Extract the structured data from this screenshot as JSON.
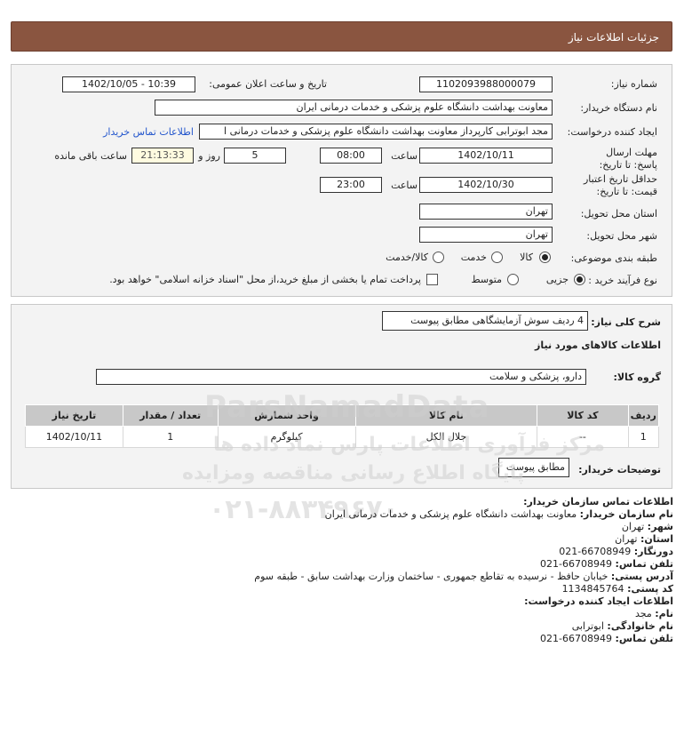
{
  "header": {
    "title": "جزئیات اطلاعات نیاز"
  },
  "form": {
    "need_number_label": "شماره نیاز:",
    "need_number": "1102093988000079",
    "announce_label": "تاریخ و ساعت اعلان عمومی:",
    "announce_value": "1402/10/05 - 10:39",
    "buyer_org_label": "نام دستگاه خریدار:",
    "buyer_org": "معاونت بهداشت دانشگاه علوم پزشکی و خدمات درمانی ایران",
    "creator_label": "ایجاد کننده درخواست:",
    "creator": "مجد ابوترابی کارپرداز معاونت بهداشت دانشگاه علوم پزشکی و خدمات درمانی ا",
    "contact_link": "اطلاعات تماس خریدار",
    "deadline_label": "مهلت ارسال پاسخ: تا تاریخ:",
    "deadline_date": "1402/10/11",
    "time_label": "ساعت",
    "deadline_time": "08:00",
    "days": "5",
    "days_label": "روز و",
    "remaining": "21:13:33",
    "remaining_label": "ساعت باقی مانده",
    "validity_label": "حداقل تاریخ اعتبار قیمت: تا تاریخ:",
    "validity_date": "1402/10/30",
    "validity_time_label": "ساعت",
    "validity_time": "23:00",
    "province_label": "استان محل تحویل:",
    "province": "تهران",
    "city_label": "شهر محل تحویل:",
    "city": "تهران",
    "category_label": "طبقه بندی موضوعی:",
    "category_options": [
      "کالا",
      "خدمت",
      "کالا/خدمت"
    ],
    "process_label": "نوع فرآیند خرید :",
    "process_options": [
      "جزیی",
      "متوسط"
    ],
    "payment_note": "پرداخت تمام یا بخشی از مبلغ خرید،از محل \"اسناد خزانه اسلامی\" خواهد بود."
  },
  "details": {
    "summary_label": "شرح کلی نیاز:",
    "summary": "4 ردیف سوش آزمایشگاهی مطابق پیوست",
    "goods_info_title": "اطلاعات کالاهای مورد نیاز",
    "group_label": "گروه کالا:",
    "group": "دارو، پزشکی و سلامت",
    "table_headers": [
      "ردیف",
      "کد کالا",
      "نام کالا",
      "واحد شمارش",
      "تعداد / مقدار",
      "تاریخ نیاز"
    ],
    "rows": [
      [
        "1",
        "--",
        "جلال الکل",
        "کیلوگرم",
        "1",
        "1402/10/11"
      ]
    ],
    "buyer_notes_label": "توضیحات خریدار:",
    "buyer_notes": "مطابق پیوست"
  },
  "contact": {
    "title": "اطلاعات تماس سازمان خریدار:",
    "org_label": "نام سازمان خریدار:",
    "org": "معاونت بهداشت دانشگاه علوم پزشکی و خدمات درمانی ایران",
    "city_label": "شهر:",
    "city": "تهران",
    "province_label": "استان:",
    "province": "تهران",
    "fax_label": "دورنگار:",
    "fax": "66708949-021",
    "phone_label": "تلفن تماس:",
    "phone": "66708949-021",
    "address_label": "آدرس پستی:",
    "address": "خیابان حافظ - نرسیده به تقاطع جمهوری - ساختمان وزارت بهداشت سابق - طبقه سوم",
    "postal_label": "کد پستی:",
    "postal": "1134845764",
    "creator_title": "اطلاعات ایجاد کننده درخواست:",
    "name_label": "نام:",
    "name": "مجد",
    "family_label": "نام خانوادگی:",
    "family": "ابوترابی",
    "creator_phone_label": "تلفن تماس:",
    "creator_phone": "66708949-021"
  },
  "watermark": {
    "brand": "ParsNamadData",
    "line1": "مرکز فرآوری اطلاعات پارس نماد داده ها",
    "line2": "پایگاه اطلاع رسانی مناقصه ومزایده",
    "phone": "۰۲۱-۸۸۳۴۹۶۷۰"
  }
}
